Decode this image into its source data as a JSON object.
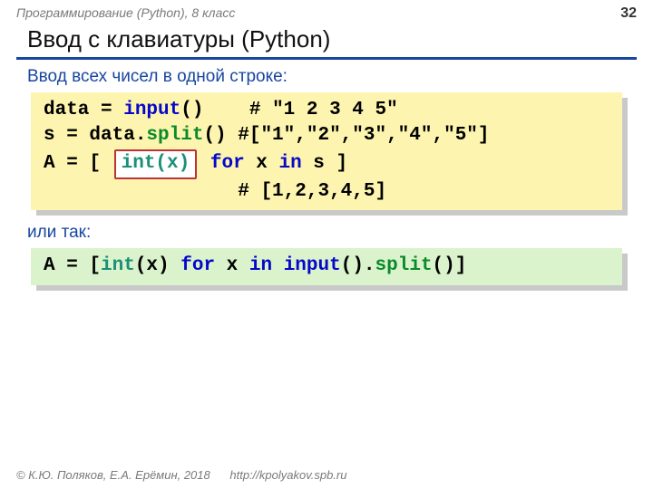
{
  "header": {
    "course": "Программирование (Python), 8 класс",
    "page": "32"
  },
  "title": "Ввод с клавиатуры (Python)",
  "subtitle": "Ввод всех чисел в одной строке:",
  "code1": {
    "l1_a": "data = ",
    "l1_kw": "input",
    "l1_b": "()    ",
    "l1_c": "# \"1 2 3 4 5\"",
    "l2_a": "s = data.",
    "l2_kw": "split",
    "l2_b": "() ",
    "l2_c": "#[\"1\",\"2\",\"3\",\"4\",\"5\"]",
    "l3_a": "A = [ ",
    "l3_inset": "int(x)",
    "l3_b": " ",
    "l3_for": "for",
    "l3_c": " x ",
    "l3_in": "in",
    "l3_d": " s ]",
    "l4_pad": "                 ",
    "l4_c": "# [1,2,3,4,5]"
  },
  "or_so": "или так:",
  "code2": {
    "a": "A = [",
    "int": "int",
    "b": "(x) ",
    "for": "for",
    "c": " x ",
    "in": "in",
    "d": " ",
    "input": "input",
    "e": "().",
    "split": "split",
    "f": "()]"
  },
  "footer": {
    "copyright": "© К.Ю. Поляков, Е.А. Ерёмин, 2018",
    "link": "http://kpolyakov.spb.ru"
  }
}
